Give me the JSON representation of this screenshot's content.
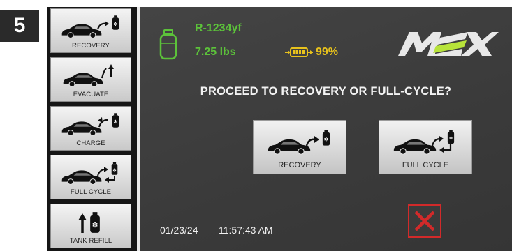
{
  "step_number": "5",
  "sidebar": {
    "items": [
      {
        "label": "RECOVERY",
        "icon": "car-recovery-icon"
      },
      {
        "label": "EVACUATE",
        "icon": "car-evacuate-icon"
      },
      {
        "label": "CHARGE",
        "icon": "car-charge-icon"
      },
      {
        "label": "FULL CYCLE",
        "icon": "car-full-cycle-icon"
      },
      {
        "label": "TANK REFILL",
        "icon": "tank-refill-icon"
      }
    ]
  },
  "status": {
    "refrigerant": "R-1234yf",
    "weight": "7.25 lbs",
    "battery": "99%",
    "battery_level_percent": 99
  },
  "prompt": "PROCEED TO RECOVERY OR FULL-CYCLE?",
  "actions": [
    {
      "label": "RECOVERY"
    },
    {
      "label": "FULL CYCLE"
    }
  ],
  "footer": {
    "date": "01/23/24",
    "time": "11:57:43 AM"
  },
  "colors": {
    "status_green": "#5cc23a",
    "battery_yellow": "#e8c21c",
    "cancel_red": "#d22a2a",
    "screen_bg": "#3e3e3e"
  }
}
